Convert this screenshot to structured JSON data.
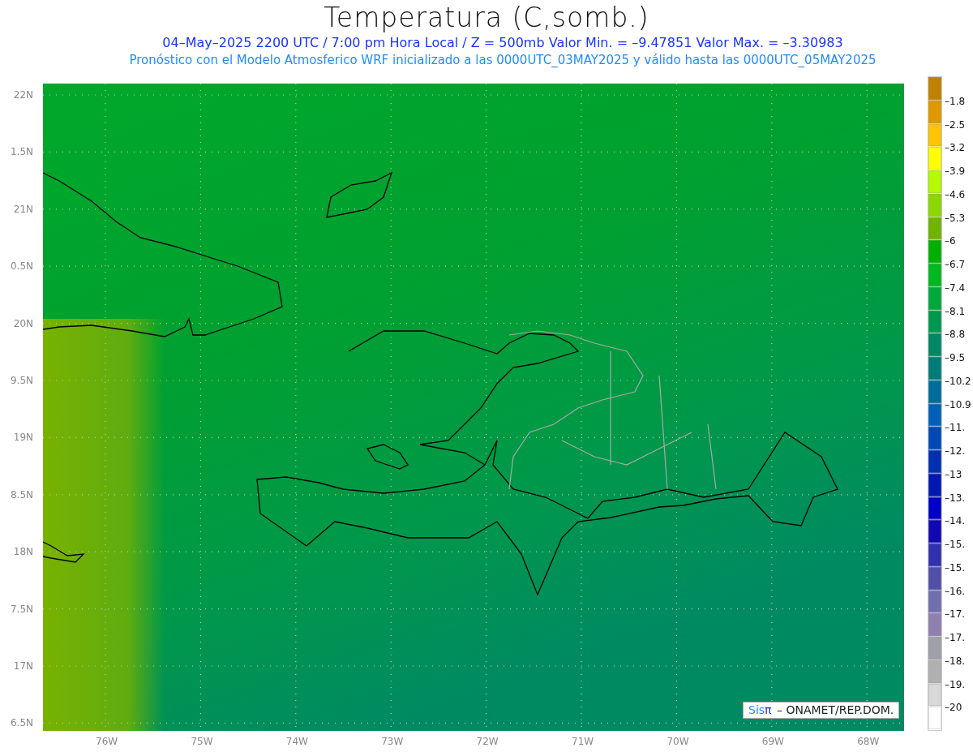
{
  "title": "Temperatura (C,somb.)",
  "subtitle": "04–May–2025  2200 UTC / 7:00 pm Hora Local / Z = 500mb  Valor Min. = –9.47851  Valor Max. = –3.30983",
  "description": "Pronóstico con el Modelo Atmosferico WRF inicializado a las 0000UTC_03MAY2025 y válido hasta las  0000UTC_05MAY2025",
  "map": {
    "y_labels": [
      "22N",
      "1.5N",
      "21N",
      "0.5N",
      "20N",
      "9.5N",
      "19N",
      "8.5N",
      "18N",
      "7.5N",
      "17N",
      "6.5N"
    ],
    "x_labels": [
      "76W",
      "75W",
      "74W",
      "73W",
      "72W",
      "71W",
      "70W",
      "69W",
      "68W"
    ],
    "credit": {
      "brand": "Sis",
      "brand_symbol": "π",
      "text": "– ONAMET/REP.DOM."
    }
  },
  "colorbar": [
    {
      "color": "#c08000"
    },
    {
      "color": "#e09800",
      "label": "–1.8"
    },
    {
      "color": "#ffc400",
      "label": "–2.5"
    },
    {
      "color": "#ffff00",
      "label": "–3.2"
    },
    {
      "color": "#b4fa00",
      "label": "–3.9"
    },
    {
      "color": "#8cd800",
      "label": "–4.6"
    },
    {
      "color": "#70b400",
      "label": "–5.3"
    },
    {
      "color": "#00b000",
      "label": "–6"
    },
    {
      "color": "#00b820",
      "label": "–6.7"
    },
    {
      "color": "#00a83c",
      "label": "–7.4"
    },
    {
      "color": "#00984c",
      "label": "–8.1"
    },
    {
      "color": "#008864",
      "label": "–8.8"
    },
    {
      "color": "#007c78",
      "label": "–9.5"
    },
    {
      "color": "#006c9c",
      "label": "–10.2"
    },
    {
      "color": "#0060b8",
      "label": "–10.9"
    },
    {
      "color": "#0048b4",
      "label": "–11."
    },
    {
      "color": "#0030b0",
      "label": "–12."
    },
    {
      "color": "#0018b0",
      "label": "–13"
    },
    {
      "color": "#0000c8",
      "label": "–13."
    },
    {
      "color": "#1008b0",
      "label": "–14."
    },
    {
      "color": "#3030b0",
      "label": "–15."
    },
    {
      "color": "#5050a8",
      "label": "–15."
    },
    {
      "color": "#7070b0",
      "label": "–16."
    },
    {
      "color": "#9080b0",
      "label": "–17."
    },
    {
      "color": "#a0a0a8",
      "label": "–17."
    },
    {
      "color": "#b0b0b0",
      "label": "–18."
    },
    {
      "color": "#d8d8d8",
      "label": "–19."
    },
    {
      "color": "#ffffff",
      "label": "–20"
    }
  ]
}
